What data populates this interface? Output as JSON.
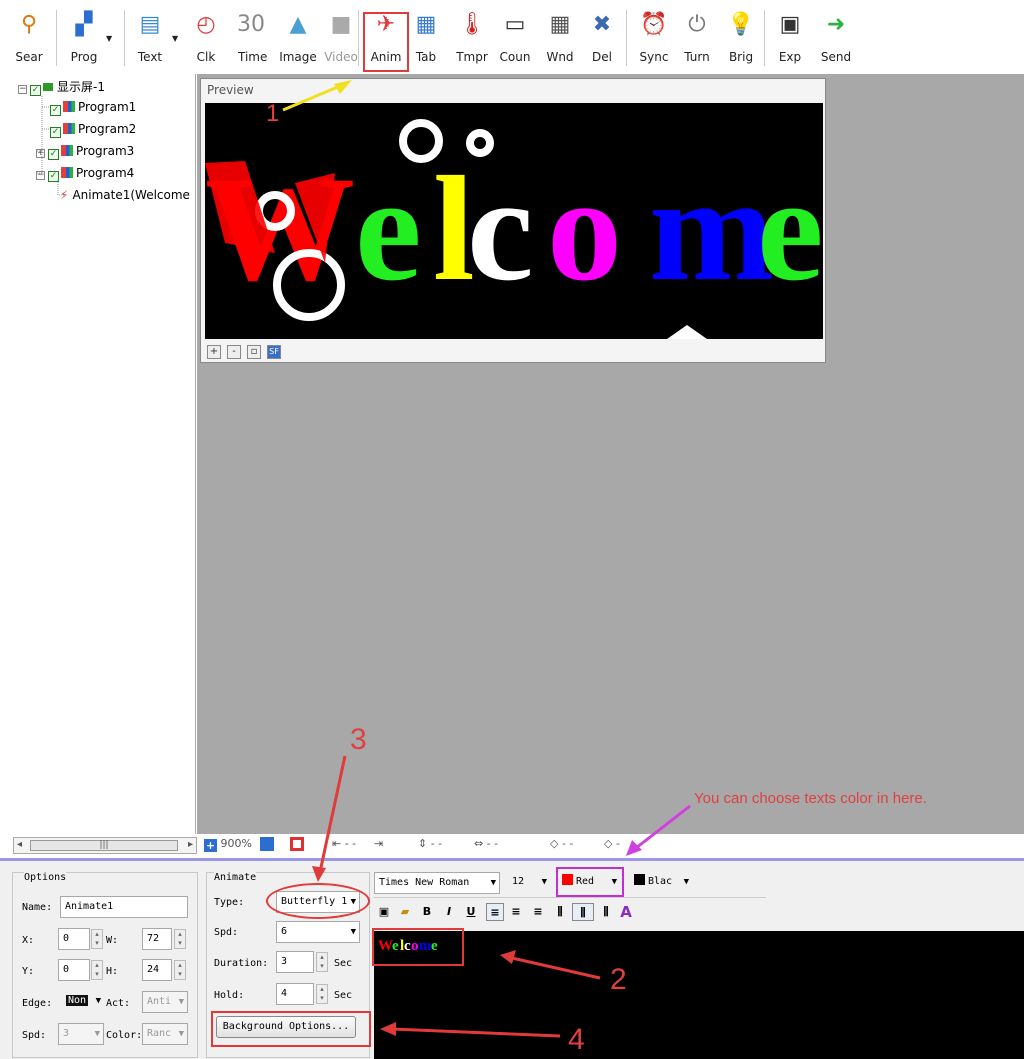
{
  "toolbar": {
    "items": [
      {
        "label": "Sear",
        "icon": "magnifier-icon"
      },
      {
        "label": "Prog",
        "icon": "program-icon"
      },
      {
        "label": "Text",
        "icon": "text-icon"
      },
      {
        "label": "Clk",
        "icon": "clock-icon"
      },
      {
        "label": "Time",
        "icon": "calendar-icon"
      },
      {
        "label": "Image",
        "icon": "image-icon"
      },
      {
        "label": "Video",
        "icon": "video-icon",
        "disabled": true
      },
      {
        "label": "Anim",
        "icon": "animation-icon"
      },
      {
        "label": "Tab",
        "icon": "table-icon"
      },
      {
        "label": "Tmpr",
        "icon": "thermometer-icon"
      },
      {
        "label": "Coun",
        "icon": "counter-icon"
      },
      {
        "label": "Wnd",
        "icon": "window-icon"
      },
      {
        "label": "Del",
        "icon": "delete-icon"
      },
      {
        "label": "Sync",
        "icon": "alarm-icon"
      },
      {
        "label": "Turn",
        "icon": "power-icon"
      },
      {
        "label": "Brig",
        "icon": "bulb-icon"
      },
      {
        "label": "Exp",
        "icon": "export-icon"
      },
      {
        "label": "Send",
        "icon": "send-icon"
      }
    ]
  },
  "tree": {
    "root": "显示屏-1",
    "programs": [
      "Program1",
      "Program2",
      "Program3",
      "Program4"
    ],
    "child": "Animate1(Welcome"
  },
  "preview": {
    "title": "Preview",
    "led_text": "Welcome",
    "led_colors": [
      "#ff0000",
      "#22ee22",
      "#ffff00",
      "#ffffff",
      "#ff00ff",
      "#0000ff",
      "#22ee22"
    ],
    "tools": [
      "+",
      "-",
      "▫",
      "SF"
    ]
  },
  "zoombar": {
    "zoom": "900%",
    "dashes": "- -"
  },
  "options": {
    "legend": "Options",
    "name_label": "Name:",
    "name_value": "Animate1",
    "x_label": "X:",
    "x_value": "0",
    "w_label": "W:",
    "w_value": "72",
    "y_label": "Y:",
    "y_value": "0",
    "h_label": "H:",
    "h_value": "24",
    "edge_label": "Edge:",
    "edge_value": "Non",
    "act_label": "Act:",
    "act_value": "Anti",
    "spd_label": "Spd:",
    "spd_value": "3",
    "color_label": "Color:",
    "color_value": "Ranc"
  },
  "animate": {
    "legend": "Animate",
    "type_label": "Type:",
    "type_value": "Butterfly 1",
    "spd_label": "Spd:",
    "spd_value": "6",
    "duration_label": "Duration:",
    "duration_value": "3",
    "duration_unit": "Sec",
    "hold_label": "Hold:",
    "hold_value": "4",
    "hold_unit": "Sec",
    "bg_button": "Background Options..."
  },
  "format": {
    "font": "Times New Roman",
    "size": "12",
    "text_color": "Red",
    "bg_color": "Blac",
    "bold": "B",
    "italic": "I",
    "underline": "U"
  },
  "editor": {
    "text": "Welcome"
  },
  "annotations": {
    "n1": "1",
    "n2": "2",
    "n3": "3",
    "n4": "4",
    "color_hint": "You can choose texts color in here."
  }
}
